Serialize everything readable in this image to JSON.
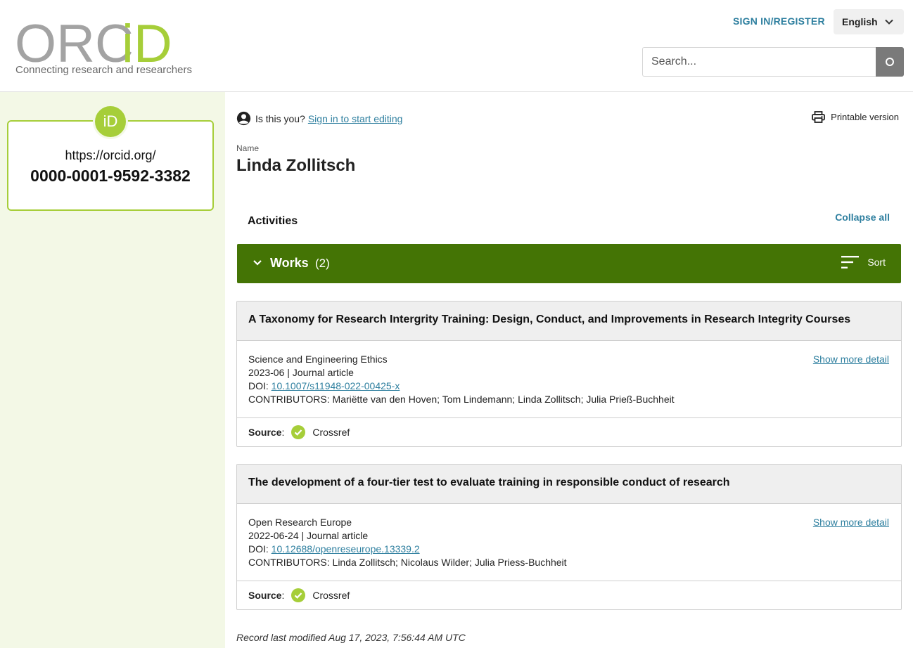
{
  "header": {
    "logo_text_gray": "ORC",
    "logo_text_green": "iD",
    "tagline": "Connecting research and researchers",
    "signin_label": "SIGN IN/REGISTER",
    "language": "English",
    "search_placeholder": "Search...",
    "brand_green": "#a6ce39",
    "brand_gray": "#a3a3a3"
  },
  "sidebar": {
    "badge_text": "iD",
    "orcid_url": "https://orcid.org/",
    "orcid_id": "0000-0001-9592-3382"
  },
  "main": {
    "is_this_you": "Is this you?",
    "sign_in_edit": "Sign in to start editing",
    "printable": "Printable version",
    "name_label": "Name",
    "name": "Linda Zollitsch",
    "activities": "Activities",
    "collapse_all": "Collapse all",
    "works": {
      "title": "Works",
      "count": "(2)",
      "sort_label": "Sort",
      "bar_color": "#447405"
    },
    "items": [
      {
        "title": "A Taxonomy for Research Intergrity Training: Design, Conduct, and Improvements in Research Integrity Courses",
        "journal": "Science and Engineering Ethics",
        "date_type": "2023-06 | Journal article",
        "doi_label": "DOI: ",
        "doi": "10.1007/s11948-022-00425-x",
        "contributors": "CONTRIBUTORS: Mariëtte van den Hoven; Tom Lindemann; Linda Zollitsch; Julia Prieß-Buchheit",
        "show_more": "Show more detail",
        "source_label": "Source",
        "source": "Crossref"
      },
      {
        "title": "The development of a four-tier test to evaluate training in responsible conduct of research",
        "journal": "Open Research Europe",
        "date_type": "2022-06-24 | Journal article",
        "doi_label": "DOI: ",
        "doi": "10.12688/openreseurope.13339.2",
        "contributors": "CONTRIBUTORS: Linda Zollitsch; Nicolaus Wilder; Julia Priess-Buchheit",
        "show_more": "Show more detail",
        "source_label": "Source",
        "source": "Crossref"
      }
    ],
    "last_modified": "Record last modified Aug 17, 2023, 7:56:44 AM UTC"
  }
}
